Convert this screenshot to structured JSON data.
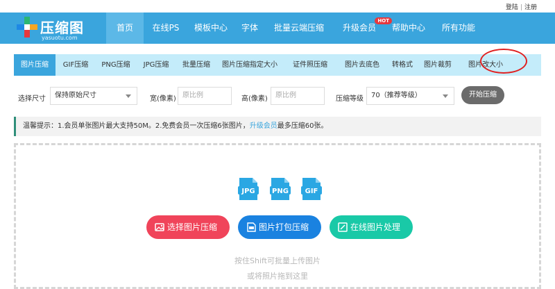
{
  "toplinks": {
    "login": "登陆",
    "sep": "|",
    "register": "注册"
  },
  "logo": {
    "title": "压缩图",
    "subtitle": "yasuotu.com"
  },
  "nav": [
    {
      "label": "首页",
      "active": true
    },
    {
      "label": "在线PS"
    },
    {
      "label": "模板中心"
    },
    {
      "label": "字体"
    },
    {
      "label": "批量云端压缩"
    },
    {
      "label": "升级会员",
      "badge": "HOT"
    },
    {
      "label": "帮助中心"
    },
    {
      "label": "所有功能"
    }
  ],
  "tabs": [
    {
      "label": "图片压缩",
      "active": true
    },
    {
      "label": "GIF压缩"
    },
    {
      "label": "PNG压缩"
    },
    {
      "label": "JPG压缩"
    },
    {
      "label": "批量压缩"
    },
    {
      "label": "图片压缩指定大小"
    },
    {
      "label": "证件照压缩"
    },
    {
      "label": "图片去底色"
    },
    {
      "label": "转格式"
    },
    {
      "label": "图片裁剪"
    },
    {
      "label": "图片改大小",
      "highlighted": true
    }
  ],
  "options": {
    "size_label": "选择尺寸",
    "size_value": "保持原始尺寸",
    "width_label": "宽(像素)",
    "width_placeholder": "原比例",
    "height_label": "高(像素)",
    "height_placeholder": "原比例",
    "level_label": "压缩等级",
    "level_value": "70（推荐等级）",
    "start_label": "开始压缩"
  },
  "notice": {
    "text_before": "温馨提示：1.会员单张图片最大支持50M。2.免费会员一次压缩6张图片，",
    "link": "升级会员",
    "text_after": "最多压缩60张。"
  },
  "upload": {
    "formats": [
      "JPG",
      "PNG",
      "GIF"
    ],
    "buttons": {
      "select": "选择图片压缩",
      "pack": "图片打包压缩",
      "online": "在线图片处理"
    },
    "hint1": "按住Shift可批量上传图片",
    "hint2": "或将照片拖到这里"
  },
  "colors": {
    "brand": "#3aa5dd",
    "tabs_bg": "#c4ecfa",
    "red": "#f0445a",
    "blue": "#1a82e0",
    "green": "#19c9a7",
    "highlight": "#e02020"
  }
}
